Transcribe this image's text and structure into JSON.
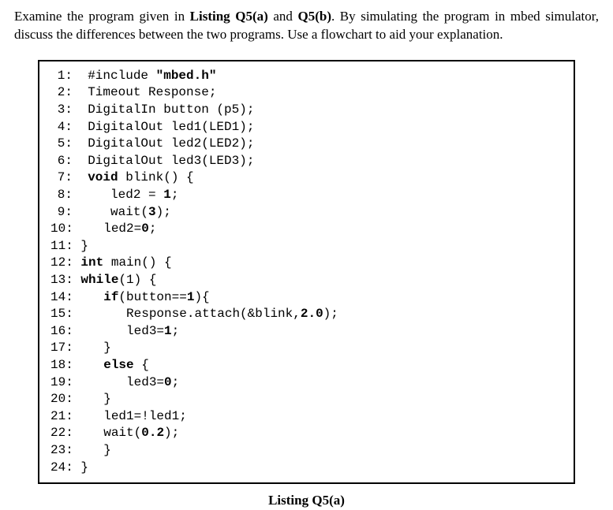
{
  "question": {
    "part1": "Examine the program given in ",
    "ref1": "Listing Q5(a)",
    "part2": " and ",
    "ref2": "Q5(b)",
    "part3": ". By simulating the program in mbed simulator, discuss the differences between the two programs. Use a flowchart to aid your explanation."
  },
  "code": {
    "lines": [
      {
        "n": "1:",
        "a": "  #include ",
        "b": "\"mbed.h\"",
        "c": ""
      },
      {
        "n": "2:",
        "a": "  Timeout Response;",
        "b": "",
        "c": ""
      },
      {
        "n": "3:",
        "a": "  DigitalIn button (p5);",
        "b": "",
        "c": ""
      },
      {
        "n": "4:",
        "a": "  DigitalOut led1(LED1);",
        "b": "",
        "c": ""
      },
      {
        "n": "5:",
        "a": "  DigitalOut led2(LED2);",
        "b": "",
        "c": ""
      },
      {
        "n": "6:",
        "a": "  DigitalOut led3(LED3);",
        "b": "",
        "c": ""
      },
      {
        "n": "7:",
        "a": "  ",
        "b": "void",
        "c": " blink() {"
      },
      {
        "n": "8:",
        "a": "     led2 = ",
        "b": "1",
        "c": ";"
      },
      {
        "n": "9:",
        "a": "     wait(",
        "b": "3",
        "c": ");"
      },
      {
        "n": "10:",
        "a": "    led2=",
        "b": "0",
        "c": ";"
      },
      {
        "n": "11:",
        "a": " }",
        "b": "",
        "c": ""
      },
      {
        "n": "12:",
        "a": " ",
        "b": "int",
        "c": " main() {"
      },
      {
        "n": "13:",
        "a": " ",
        "b": "while",
        "c": "(1) {"
      },
      {
        "n": "14:",
        "a": "    ",
        "b": "if",
        "c": "(button==",
        "d": "1",
        "e": "){"
      },
      {
        "n": "15:",
        "a": "       Response.attach(&blink,",
        "b": "2.0",
        "c": ");"
      },
      {
        "n": "16:",
        "a": "       led3=",
        "b": "1",
        "c": ";"
      },
      {
        "n": "17:",
        "a": "    }",
        "b": "",
        "c": ""
      },
      {
        "n": "18:",
        "a": "    ",
        "b": "else",
        "c": " {"
      },
      {
        "n": "19:",
        "a": "       led3=",
        "b": "0",
        "c": ";"
      },
      {
        "n": "20:",
        "a": "    }",
        "b": "",
        "c": ""
      },
      {
        "n": "21:",
        "a": "    led1=!led1;",
        "b": "",
        "c": ""
      },
      {
        "n": "22:",
        "a": "    wait(",
        "b": "0.2",
        "c": ");"
      },
      {
        "n": "23:",
        "a": "    }",
        "b": "",
        "c": ""
      },
      {
        "n": "24:",
        "a": " }",
        "b": "",
        "c": ""
      }
    ]
  },
  "caption": "Listing Q5(a)"
}
